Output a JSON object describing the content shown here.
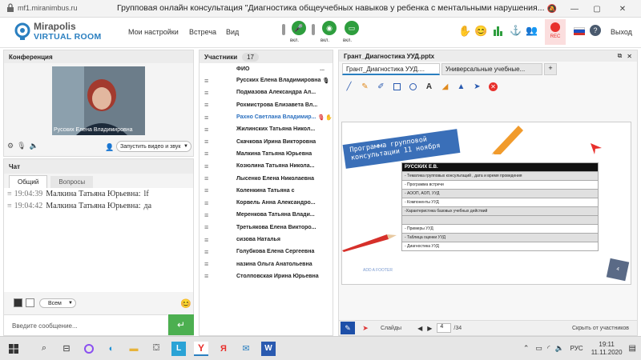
{
  "browser": {
    "url": "mf1.miranimbus.ru",
    "title": "Групповая онлайн консультация \"Диагностика общеучебных навыков у ребенка с ментальными нарушения...",
    "icons": [
      "lock-icon",
      "bell-icon",
      "restore-icon",
      "minimize-icon",
      "maximize-icon",
      "close-icon"
    ]
  },
  "header": {
    "logo_top": "Mirapolis",
    "logo_bottom": "VIRTUAL ROOM",
    "menu": [
      "Мои настройки",
      "Встреча",
      "Вид"
    ],
    "toggle_label": "вкл.",
    "rec_label": "REC",
    "exit_label": "Выход",
    "colors": {
      "green": "#2e9e3e",
      "rec": "#e8302c",
      "brand": "#2a7fc0"
    }
  },
  "conference": {
    "title": "Конференция",
    "presenter_name": "Русских Елена Владимировна",
    "start_button": "Запустить видео и звук"
  },
  "chat": {
    "title": "Чат",
    "tabs": [
      "Общий",
      "Вопросы"
    ],
    "messages": [
      {
        "time": "19:04:39",
        "author": "Малкина Татьяна  Юрьевна:",
        "text": "lf"
      },
      {
        "time": "19:04:42",
        "author": "Малкина Татьяна  Юрьевна:",
        "text": "да"
      }
    ],
    "recipient": "Всем",
    "input_placeholder": "Введите сообщение..."
  },
  "participants": {
    "title": "Участники",
    "count": "17",
    "column": "ФИО",
    "more": "...",
    "list": [
      "Русских Елена Владимировна",
      "Подмазова  Александра Ал...",
      "Рохмистрова  Елизавета Вл...",
      "Рахно Светлана  Владимир...",
      "Жилинских  Татьяна  Никол...",
      "Скачкова Ирина Викторовна",
      "Малкина Татьяна  Юрьевна",
      "Козюлина  Татьяна Никола...",
      "Лысенко Елена Николаевна",
      "Коленкина  Татьяна  с",
      "Корвель Анна  Александро...",
      "Меренкова  Татьяна  Влади...",
      "Третьякова  Елена Викторо...",
      "сизова  Наталья",
      "Голубкова  Елена Сергеевна",
      "назина  Ольга Анатольевна",
      "Столповская Ирина Юрьевна"
    ]
  },
  "presentation": {
    "title": "Грант_Диагностика УУД.pptx",
    "tabs": [
      "Грант_Диагностика УУД....",
      "Универсальные учебные..."
    ],
    "add_tab": "+",
    "slide": {
      "banner": "Программа групповой консультации 11 ноября",
      "table_header": "РУССКИХ Е.В.",
      "rows": [
        "- Тематика групповых консультаций , дата и время проведения",
        "- Программа встречи",
        "- АООП, АОП, УУД",
        "- Компоненты УУД",
        "-Характеристика базовых учебных действий",
        "",
        "- Примеры УУД",
        "- Таблица оценки УУД",
        "- Диагностика УУД"
      ],
      "footer": "ADD A FOOTER",
      "page_num": "4"
    },
    "slides_label": "Слайды",
    "current_page": "4",
    "total_pages": "/34",
    "hide_label": "Скрыть от участников"
  },
  "taskbar": {
    "lang": "РУС",
    "time": "19:11",
    "date": "11.11.2020"
  }
}
